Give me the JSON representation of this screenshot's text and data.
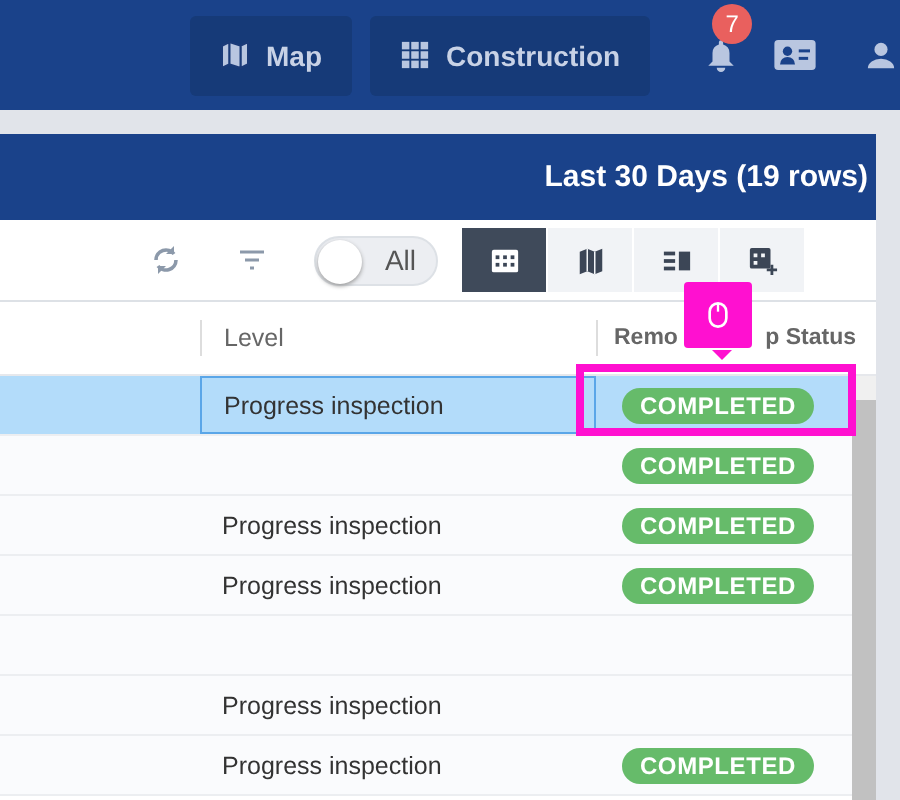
{
  "top_bar": {
    "buttons": [
      {
        "kind": "map",
        "label": "Map"
      },
      {
        "kind": "grid",
        "label": "Construction"
      }
    ],
    "notifications": {
      "badge": "7"
    }
  },
  "panel": {
    "title": "Last 30 Days (19 rows)"
  },
  "toolbar": {
    "toggle": {
      "label": "All",
      "on": false
    },
    "views": [
      {
        "kind": "table",
        "selected": true
      },
      {
        "kind": "map",
        "selected": false
      },
      {
        "kind": "split",
        "selected": false
      },
      {
        "kind": "add-table",
        "selected": false
      }
    ]
  },
  "table": {
    "columns": [
      {
        "label": "Level"
      },
      {
        "label": "Remo",
        "label_tail": "p Status"
      }
    ],
    "rows": [
      {
        "level": "Progress inspection",
        "status": "COMPLETED",
        "selected": true
      },
      {
        "status": "COMPLETED",
        "selected": false
      },
      {
        "level": "Progress inspection",
        "status": "COMPLETED",
        "selected": false
      },
      {
        "level": "Progress inspection",
        "status": "COMPLETED",
        "selected": false
      },
      {
        "selected": false
      },
      {
        "level": "Progress inspection",
        "selected": false
      },
      {
        "level": "Progress inspection",
        "status": "COMPLETED",
        "selected": false
      }
    ]
  }
}
